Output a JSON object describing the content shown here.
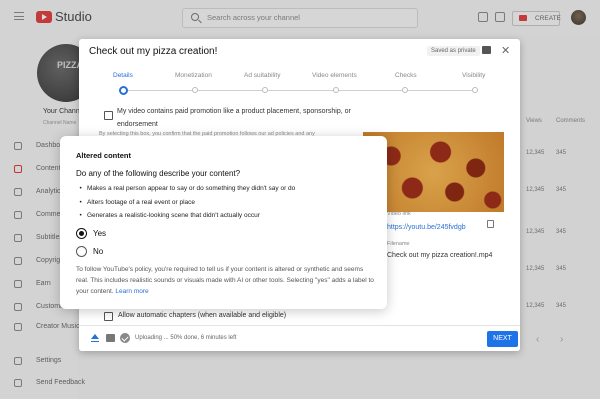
{
  "topbar": {
    "app_name": "Studio",
    "search_placeholder": "Search across your channel",
    "create_label": "CREATE"
  },
  "sidebar": {
    "avatar_text": "PIZZA",
    "channel_name": "Your Channel",
    "channel_sub": "Channel Name",
    "items": [
      {
        "label": "Dashboard",
        "icon": "dashboard-icon"
      },
      {
        "label": "Content",
        "icon": "content-icon"
      },
      {
        "label": "Analytics",
        "icon": "analytics-icon"
      },
      {
        "label": "Comments",
        "icon": "comments-icon"
      },
      {
        "label": "Subtitles",
        "icon": "subtitles-icon"
      },
      {
        "label": "Copyright",
        "icon": "copyright-icon"
      },
      {
        "label": "Earn",
        "icon": "earn-icon"
      },
      {
        "label": "Customization",
        "icon": "customization-icon"
      },
      {
        "label": "Creator Music",
        "icon": "music-icon"
      },
      {
        "label": "Settings",
        "icon": "gear-icon"
      },
      {
        "label": "Send Feedback",
        "icon": "feedback-icon"
      }
    ]
  },
  "table": {
    "columns": [
      "Views",
      "Comments"
    ],
    "rows": [
      [
        "12,345",
        "345"
      ],
      [
        "12,345",
        "345"
      ],
      [
        "12,345",
        "345"
      ],
      [
        "12,345",
        "345"
      ],
      [
        "12,345",
        "345"
      ]
    ]
  },
  "upload_dialog": {
    "title": "Check out my pizza creation!",
    "saved_label": "Saved as private",
    "steps": [
      "Details",
      "Monetization",
      "Ad suitability",
      "Video elements",
      "Checks",
      "Visibility"
    ],
    "active_step": 0,
    "promo_label": "My video contains paid promotion like a product placement, sponsorship, or endorsement",
    "promo_sub": "By selecting this box, you confirm that the paid promotion follows our ad policies and any",
    "video_link_label": "Video link",
    "video_link": "https://youtu.be/245fvdgb",
    "filename_label": "Filename",
    "filename": "Check out my pizza creation!.mp4",
    "chapters_label": "Allow automatic chapters (when available and eligible)",
    "uploading_status": "Uploading ... 50% done, 6 minutes left",
    "next_label": "NEXT"
  },
  "altered_dialog": {
    "title": "Altered content",
    "question": "Do any of the following describe your content?",
    "bullets": [
      "Makes a real person appear to say or do something they didn't say or do",
      "Alters footage of a real event or place",
      "Generates a realistic-looking scene that didn't actually occur"
    ],
    "options": [
      "Yes",
      "No"
    ],
    "selected_option": "Yes",
    "policy_text": "To follow YouTube's policy, you're required to tell us if your content is altered or synthetic and seems real. This includes realistic sounds or visuals made with AI or other tools. Selecting \"yes\" adds a label to your content.",
    "learn_more": "Learn more"
  },
  "colors": {
    "accent_blue": "#1f73e8",
    "youtube_red": "#e03a3a"
  }
}
